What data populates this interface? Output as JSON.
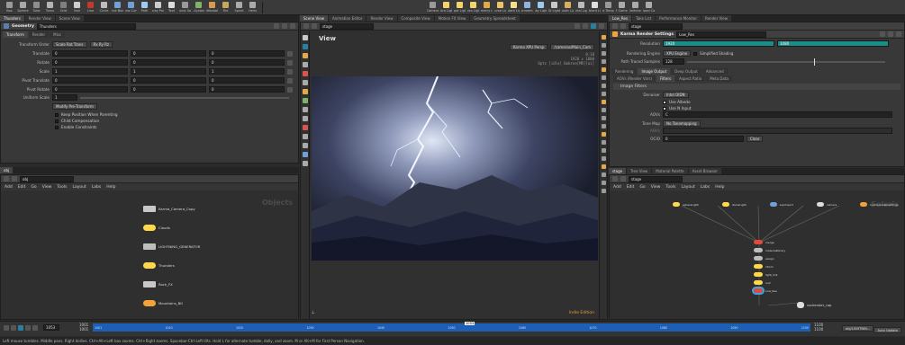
{
  "shelf_tools": [
    {
      "label": "Box",
      "icon": "box-icon",
      "color": "#9a9a9a"
    },
    {
      "label": "Sphere",
      "icon": "sphere-icon",
      "color": "#a8a8a8"
    },
    {
      "label": "Tube",
      "icon": "tube-icon",
      "color": "#8d8d8d"
    },
    {
      "label": "Torus",
      "icon": "torus-icon",
      "color": "#b3b3b3"
    },
    {
      "label": "Grid",
      "icon": "grid-icon",
      "color": "#7f7f7f"
    },
    {
      "label": "Null",
      "icon": "null-icon",
      "color": "#cfcfcf"
    },
    {
      "label": "Line",
      "icon": "line-icon",
      "color": "#c0392b"
    },
    {
      "label": "Circle",
      "icon": "circle-icon",
      "color": "#bdbdbd"
    },
    {
      "label": "Curve Bezier",
      "icon": "curve-icon",
      "color": "#6fa0d8"
    },
    {
      "label": "Draw Curve",
      "icon": "draw-curve-icon",
      "color": "#6fa0d8"
    },
    {
      "label": "Path",
      "icon": "path-icon",
      "color": "#9ecbf0"
    },
    {
      "label": "Spray Paint",
      "icon": "spray-icon",
      "color": "#ccc"
    },
    {
      "label": "Text",
      "icon": "text-icon",
      "color": "#ddd"
    },
    {
      "label": "Platonic Solids",
      "icon": "platonic-icon",
      "color": "#999"
    },
    {
      "label": "L-System",
      "icon": "lsystem-icon",
      "color": "#7fb36a"
    },
    {
      "label": "Metaball",
      "icon": "metaball-icon",
      "color": "#d99a4e"
    },
    {
      "label": "File",
      "icon": "file-icon",
      "color": "#c8a65a"
    },
    {
      "label": "Spiral",
      "icon": "spiral-icon",
      "color": "#aaa"
    },
    {
      "label": "Helix",
      "icon": "helix-icon",
      "color": "#aaa"
    }
  ],
  "shelf_tools_right": [
    {
      "label": "Camera",
      "icon": "camera-icon",
      "color": "#9a9a9a"
    },
    {
      "label": "Point Light",
      "icon": "point-light-icon",
      "color": "#f3d36b"
    },
    {
      "label": "Spot Light",
      "icon": "spot-light-icon",
      "color": "#f3d36b"
    },
    {
      "label": "Area Light",
      "icon": "area-light-icon",
      "color": "#f3d36b"
    },
    {
      "label": "Geometry Light",
      "icon": "geo-light-icon",
      "color": "#e2a94b"
    },
    {
      "label": "Volume Light",
      "icon": "volume-light-icon",
      "color": "#e9c46a"
    },
    {
      "label": "Distant Light",
      "icon": "distant-light-icon",
      "color": "#f5e08a"
    },
    {
      "label": "Environment Light",
      "icon": "env-light-icon",
      "color": "#8fb4dd"
    },
    {
      "label": "Sky Light",
      "icon": "sky-light-icon",
      "color": "#9ec9ef"
    },
    {
      "label": "GI Light",
      "icon": "gi-light-icon",
      "color": "#c9c9c9"
    },
    {
      "label": "Caustic Light",
      "icon": "caustic-light-icon",
      "color": "#d5b15e"
    },
    {
      "label": "Portal Light",
      "icon": "portal-light-icon",
      "color": "#bbb"
    },
    {
      "label": "Ambient Light",
      "icon": "ambient-light-icon",
      "color": "#ddd"
    },
    {
      "label": "Light Template",
      "icon": "light-template-icon",
      "color": "#999"
    },
    {
      "label": "VR Camera",
      "icon": "vr-camera-icon",
      "color": "#aaa"
    },
    {
      "label": "Switcher",
      "icon": "switcher-icon",
      "color": "#aaa"
    },
    {
      "label": "Gamepad Camera",
      "icon": "gamepad-icon",
      "color": "#aaa"
    }
  ],
  "left_top": {
    "tabs": [
      "Thunders",
      "Render View",
      "Scene View"
    ],
    "node_type": "Geometry",
    "node_name": "Thunders",
    "sub_tabs": [
      "Transform",
      "Render",
      "Misc"
    ],
    "transform_order": {
      "label": "Transform Order",
      "value1": "Scale Rot Trans",
      "value2": "Rx Ry Rz"
    },
    "rows": [
      {
        "label": "Translate",
        "v": [
          "0",
          "0",
          "0"
        ]
      },
      {
        "label": "Rotate",
        "v": [
          "0",
          "0",
          "0"
        ]
      },
      {
        "label": "Scale",
        "v": [
          "1",
          "1",
          "1"
        ]
      },
      {
        "label": "Pivot Translate",
        "v": [
          "0",
          "0",
          "0"
        ]
      },
      {
        "label": "Pivot Rotate",
        "v": [
          "0",
          "0",
          "0"
        ]
      }
    ],
    "uniform_scale": {
      "label": "Uniform Scale",
      "value": "1"
    },
    "modify_btn": "Modify Pre-Transform",
    "checks": [
      "Keep Position When Parenting",
      "Child Compensation",
      "Enable Constraints"
    ]
  },
  "left_bottom": {
    "tabs": [
      "obj"
    ],
    "path": "obj",
    "menu": [
      "Add",
      "Edit",
      "Go",
      "View",
      "Tools",
      "Layout",
      "Labs",
      "Help"
    ],
    "context_label": "Objects",
    "nodes": [
      {
        "name": "Karma_Camera_Copy",
        "color": "#c8c8c8"
      },
      {
        "name": "Clouds",
        "color": "#ffd84a"
      },
      {
        "name": "LIGHTNING_GENERATOR",
        "color": "#bdbdbd"
      },
      {
        "name": "Thunders",
        "color": "#ffd84a"
      },
      {
        "name": "Rock_FX",
        "color": "#c8c8c8"
      },
      {
        "name": "Mountains_BG",
        "color": "#f2a23a"
      }
    ]
  },
  "center": {
    "tabs": [
      "Scene View",
      "Animation Editor",
      "Render View",
      "Composite View",
      "Motion FX View",
      "Geometry Spreadsheet"
    ],
    "path": "stage",
    "view_label": "View",
    "renderer_dropdown": "Karma XPU  Persp",
    "camera_dropdown": "/cameras/Main_Cam",
    "overlay_lines": [
      "0:10",
      "1920 x 1080",
      "Opts [idle] Embree[MR][ai]"
    ],
    "badge": "Indie Edition"
  },
  "right_top": {
    "tabs": [
      "Low_Res",
      "Take List",
      "Performance Monitor",
      "Render View"
    ],
    "path": "stage",
    "node_type": "Karma Render Settings",
    "node_name": "Low_Res",
    "resolution": {
      "label": "Resolution",
      "w": "1920",
      "h": "1080"
    },
    "rendering_engine": {
      "label": "Rendering Engine",
      "value": "XPU Engine",
      "extra": "Simplified Shading"
    },
    "path_traced": {
      "label": "Path Traced Samples",
      "value": "128"
    },
    "tabs2": [
      "Rendering",
      "Image Output",
      "Deep Output",
      "Advanced"
    ],
    "tabs3": [
      "AOVs (Render Vars)",
      "Filters",
      "Aspect Ratio",
      "Meta Data"
    ],
    "section": "Image Filters",
    "denoiser": {
      "label": "Denoiser",
      "value": "Intel OIDN"
    },
    "checks": [
      "Use Albedo",
      "Use N Input"
    ],
    "aovs": {
      "label": "AOVs",
      "value": "C"
    },
    "tonemap": {
      "label": "Tone Map",
      "value": "No Tonemapping"
    },
    "aovs2": {
      "label": "AOVs",
      "value": ""
    },
    "ocio": {
      "label": "OCIO",
      "value": "0",
      "btn": "Clear"
    }
  },
  "right_bottom": {
    "tabs": [
      "stage",
      "Tree View",
      "Material Palette",
      "Asset Browser"
    ],
    "path": "stage",
    "menu": [
      "Add",
      "Edit",
      "Go",
      "View",
      "Tools",
      "Layout",
      "Labs",
      "Help"
    ],
    "context_label": "Solaris",
    "nodes_top": [
      {
        "name": "sphereLight",
        "color": "#ffd84a"
      },
      {
        "name": "domeLight",
        "color": "#ffd84a"
      },
      {
        "name": "sopimport",
        "color": "#6fa0d8"
      },
      {
        "name": "camera",
        "color": "#ddd"
      },
      {
        "name": "karmarendersettings",
        "color": "#f2a23a"
      }
    ],
    "chain": [
      {
        "name": "merge",
        "color": "#e04a3a"
      },
      {
        "name": "materiallibrary",
        "color": "#bdbdbd"
      },
      {
        "name": "assign",
        "color": "#bdbdbd"
      },
      {
        "name": "xform",
        "color": "#ffd84a"
      },
      {
        "name": "light_link",
        "color": "#ffd84a"
      },
      {
        "name": "null",
        "color": "#ffd84a"
      },
      {
        "name": "Low_Res",
        "color": "#e04a3a"
      }
    ],
    "side_node": {
      "name": "usdrender_rop",
      "color": "#ddd"
    }
  },
  "timeline": {
    "current_frame": "1053",
    "start": "1001",
    "end": "1100",
    "end2": "1100",
    "marker": "1053",
    "ticks": [
      "1001",
      "1010",
      "1020",
      "1030",
      "1040",
      "1050",
      "1060",
      "1070",
      "1080",
      "1090",
      "1100"
    ],
    "keys_label": "obj/LIGHTNIN...",
    "auto_update": "Auto Update"
  },
  "status_bar": "Left mouse tumbles. Middle pans. Right dollies. Ctrl+Alt+Left box zooms. Ctrl+Right zooms. Spacebar-Ctrl-Left tilts. Hold L for alternate tumble, dolly, and zoom. M or Alt+M for First Person Navigation.",
  "colors": {
    "accent": "#2a7fa0",
    "resolution_bg": "#1a8f8a",
    "timeline_bar": "#1d5fb5",
    "selected_node": "#3aa6e0"
  }
}
